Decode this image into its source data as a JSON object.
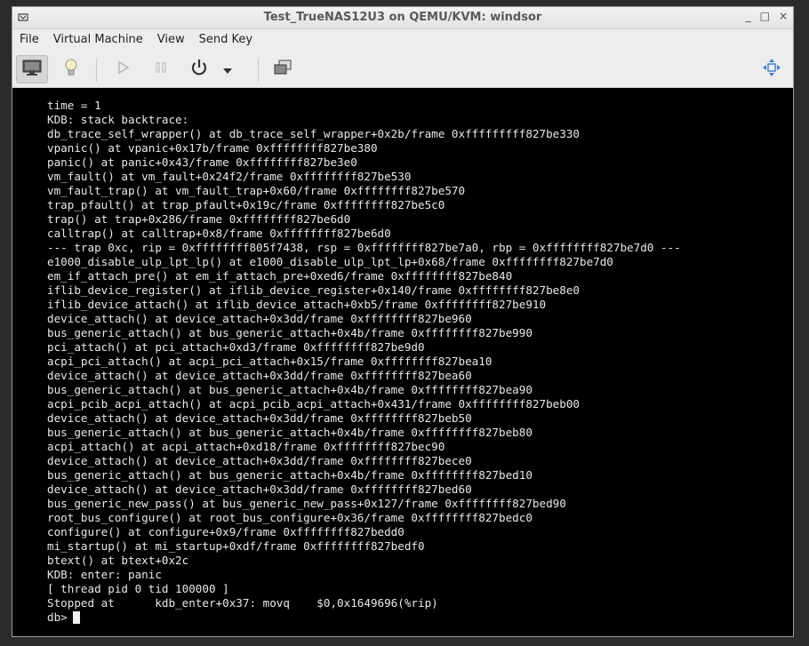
{
  "window": {
    "title": "Test_TrueNAS12U3 on QEMU/KVM: windsor",
    "controls": {
      "minimize": "_",
      "maximize": "□",
      "close": "×"
    }
  },
  "menubar": {
    "items": [
      {
        "label": "File"
      },
      {
        "label": "Virtual Machine"
      },
      {
        "label": "View"
      },
      {
        "label": "Send Key"
      }
    ]
  },
  "toolbar": {
    "icons": [
      "monitor-icon",
      "lightbulb-icon",
      "play-icon",
      "pause-icon",
      "power-icon",
      "dropdown-arrow-icon",
      "screenshot-icon",
      "fullscreen-move-icon"
    ]
  },
  "console": {
    "lines": [
      "time = 1",
      "KDB: stack backtrace:",
      "db_trace_self_wrapper() at db_trace_self_wrapper+0x2b/frame 0xfffffffff827be330",
      "vpanic() at vpanic+0x17b/frame 0xffffffff827be380",
      "panic() at panic+0x43/frame 0xffffffff827be3e0",
      "vm_fault() at vm_fault+0x24f2/frame 0xffffffff827be530",
      "vm_fault_trap() at vm_fault_trap+0x60/frame 0xffffffff827be570",
      "trap_pfault() at trap_pfault+0x19c/frame 0xffffffff827be5c0",
      "trap() at trap+0x286/frame 0xffffffff827be6d0",
      "calltrap() at calltrap+0x8/frame 0xffffffff827be6d0",
      "--- trap 0xc, rip = 0xffffffff805f7438, rsp = 0xffffffff827be7a0, rbp = 0xffffffff827be7d0 ---",
      "e1000_disable_ulp_lpt_lp() at e1000_disable_ulp_lpt_lp+0x68/frame 0xffffffff827be7d0",
      "em_if_attach_pre() at em_if_attach_pre+0xed6/frame 0xffffffff827be840",
      "iflib_device_register() at iflib_device_register+0x140/frame 0xffffffff827be8e0",
      "iflib_device_attach() at iflib_device_attach+0xb5/frame 0xffffffff827be910",
      "device_attach() at device_attach+0x3dd/frame 0xffffffff827be960",
      "bus_generic_attach() at bus_generic_attach+0x4b/frame 0xffffffff827be990",
      "pci_attach() at pci_attach+0xd3/frame 0xffffffff827be9d0",
      "acpi_pci_attach() at acpi_pci_attach+0x15/frame 0xffffffff827bea10",
      "device_attach() at device_attach+0x3dd/frame 0xffffffff827bea60",
      "bus_generic_attach() at bus_generic_attach+0x4b/frame 0xffffffff827bea90",
      "acpi_pcib_acpi_attach() at acpi_pcib_acpi_attach+0x431/frame 0xffffffff827beb00",
      "device_attach() at device_attach+0x3dd/frame 0xffffffff827beb50",
      "bus_generic_attach() at bus_generic_attach+0x4b/frame 0xffffffff827beb80",
      "acpi_attach() at acpi_attach+0xd18/frame 0xffffffff827bec90",
      "device_attach() at device_attach+0x3dd/frame 0xffffffff827bece0",
      "bus_generic_attach() at bus_generic_attach+0x4b/frame 0xffffffff827bed10",
      "device_attach() at device_attach+0x3dd/frame 0xffffffff827bed60",
      "bus_generic_new_pass() at bus_generic_new_pass+0x127/frame 0xffffffff827bed90",
      "root_bus_configure() at root_bus_configure+0x36/frame 0xffffffff827bedc0",
      "configure() at configure+0x9/frame 0xffffffff827bedd0",
      "mi_startup() at mi_startup+0xdf/frame 0xffffffff827bedf0",
      "btext() at btext+0x2c",
      "KDB: enter: panic",
      "[ thread pid 0 tid 100000 ]",
      "Stopped at      kdb_enter+0x37: movq    $0,0x1649696(%rip)"
    ],
    "prompt": "db>"
  }
}
